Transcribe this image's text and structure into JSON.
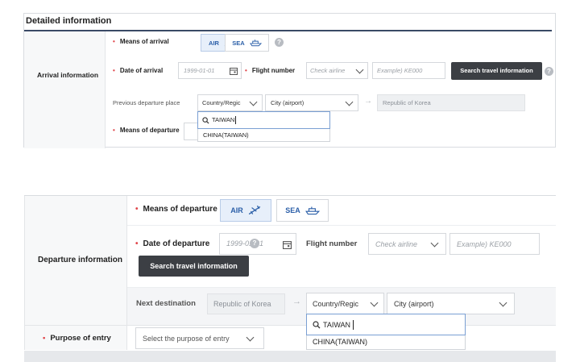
{
  "panel1": {
    "title": "Detailed information",
    "section_label": "Arrival information",
    "means_label": "Means of arrival",
    "air": "AIR",
    "sea": "SEA",
    "date_label": "Date of arrival",
    "date_value": "1999-01-01",
    "flight_label": "Flight number",
    "airline_placeholder": "Check airline",
    "flight_placeholder": "Example) KE000",
    "search_btn": "Search travel information",
    "prev_label": "Previous departure place",
    "country_value": "Country/Regic",
    "city_value": "City (airport)",
    "dest_value": "Republic of Korea",
    "search_text": "TAIWAN",
    "option": "CHINA(TAIWAN)",
    "depart_means_label": "Means of departure"
  },
  "panel2": {
    "section_label": "Departure information",
    "means_label": "Means of departure",
    "air": "AIR",
    "sea": "SEA",
    "date_label": "Date of departure",
    "date_value": "1999-01-01",
    "flight_label": "Flight number",
    "airline_placeholder": "Check airline",
    "flight_placeholder": "Example) KE000",
    "search_btn": "Search travel information",
    "next_label": "Next destination",
    "origin_value": "Republic of Korea",
    "country_value": "Country/Regic",
    "city_value": "City (airport)",
    "search_text": "TAIWAN",
    "option": "CHINA(TAIWAN)",
    "purpose_label": "Purpose of entry",
    "purpose_placeholder": "Select the purpose of entry"
  }
}
